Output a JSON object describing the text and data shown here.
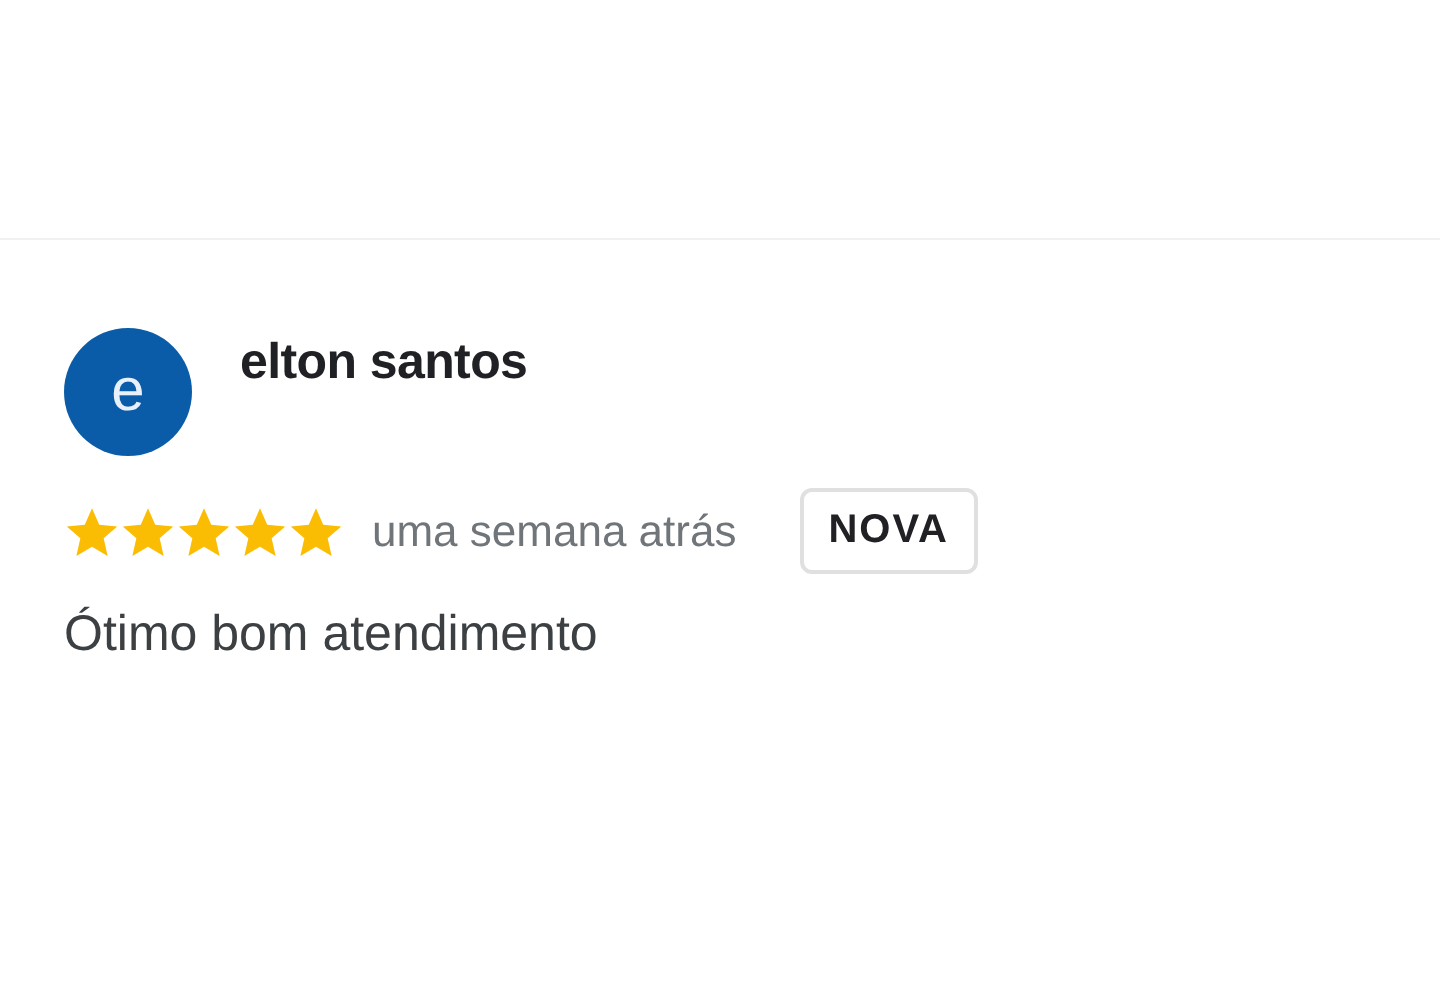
{
  "review": {
    "avatar_letter": "e",
    "author": "elton santos",
    "stars": 5,
    "time": "uma semana atrás",
    "badge": "NOVA",
    "text": "Ótimo bom atendimento"
  }
}
